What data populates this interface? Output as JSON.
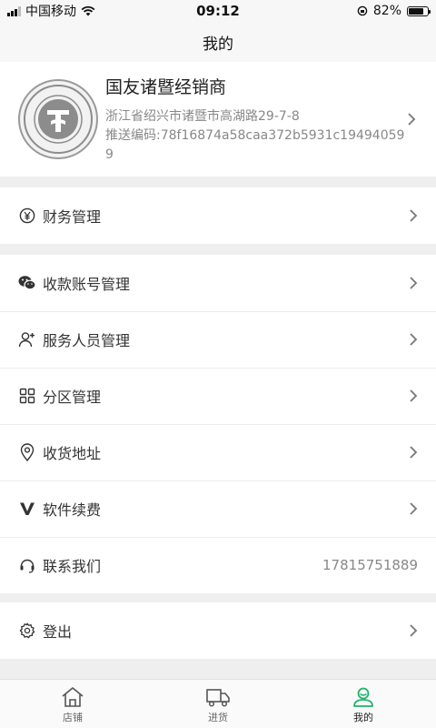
{
  "status_bar": {
    "carrier": "中国移动",
    "time": "09:12",
    "battery": "82%",
    "battery_level": 0.82
  },
  "nav": {
    "title": "我的"
  },
  "profile": {
    "name": "国友诸暨经销商",
    "address": "浙江省绍兴市诸暨市高湖路29-7-8",
    "code": "推送编码:78f16874a58caa372b5931c194940599",
    "avatar_icon": "company-seal-icon"
  },
  "menu": {
    "finance": {
      "label": "财务管理",
      "icon": "yuan-icon"
    },
    "accounts": {
      "label": "收款账号管理",
      "icon": "wechat-icon"
    },
    "staff": {
      "label": "服务人员管理",
      "icon": "add-user-icon"
    },
    "zones": {
      "label": "分区管理",
      "icon": "grid-icon"
    },
    "address": {
      "label": "收货地址",
      "icon": "location-icon"
    },
    "renew": {
      "label": "软件续费",
      "icon": "v-icon"
    },
    "contact": {
      "label": "联系我们",
      "icon": "headset-icon",
      "value": "17815751889"
    },
    "logout": {
      "label": "登出",
      "icon": "gear-icon"
    }
  },
  "tabs": [
    {
      "label": "店铺",
      "icon": "home-icon",
      "active": false
    },
    {
      "label": "进货",
      "icon": "truck-icon",
      "active": false
    },
    {
      "label": "我的",
      "icon": "user-icon",
      "active": true
    }
  ],
  "colors": {
    "accent": "#1fb36b",
    "background": "#efefef",
    "muted": "#888888"
  }
}
